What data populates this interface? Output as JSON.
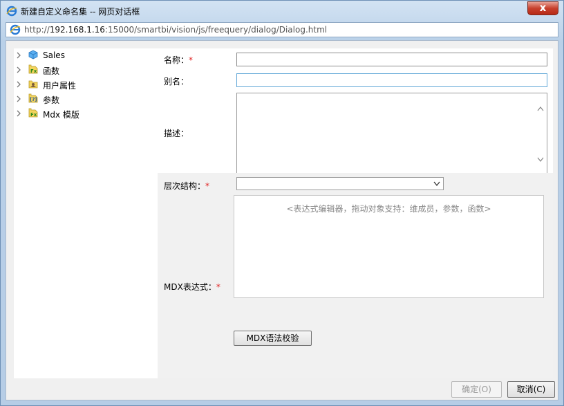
{
  "window": {
    "title": "新建自定义命名集 -- 网页对话框",
    "close_glyph": "x",
    "address": {
      "prefix": "http://",
      "host": "192.168.1.16",
      "rest": ":15000/smartbi/vision/js/freequery/dialog/Dialog.html"
    }
  },
  "tree": {
    "items": [
      {
        "label": "Sales",
        "icon": "cube-icon"
      },
      {
        "label": "函数",
        "icon": "function-icon"
      },
      {
        "label": "用户属性",
        "icon": "user-attribute-icon"
      },
      {
        "label": "参数",
        "icon": "parameter-icon"
      },
      {
        "label": "Mdx 模版",
        "icon": "mdx-template-icon"
      }
    ]
  },
  "form": {
    "name_label": "名称：",
    "alias_label": "别名：",
    "desc_label": "描述：",
    "hierarchy_label": "层次结构：",
    "mdx_label": "MDX表达式：",
    "required_mark": "*",
    "name_value": "",
    "alias_value": "",
    "desc_value": "",
    "hierarchy_value": "",
    "editor_hint": "<表达式编辑器，拖动对象支持：维成员，参数，函数>",
    "validate_button": "MDX语法校验"
  },
  "footer": {
    "ok_button": "确定(O)",
    "cancel_button": "取消(C)"
  },
  "colors": {
    "required": "#e02020",
    "focus_border": "#5fa6d6",
    "frame": "#b9d0e8"
  }
}
